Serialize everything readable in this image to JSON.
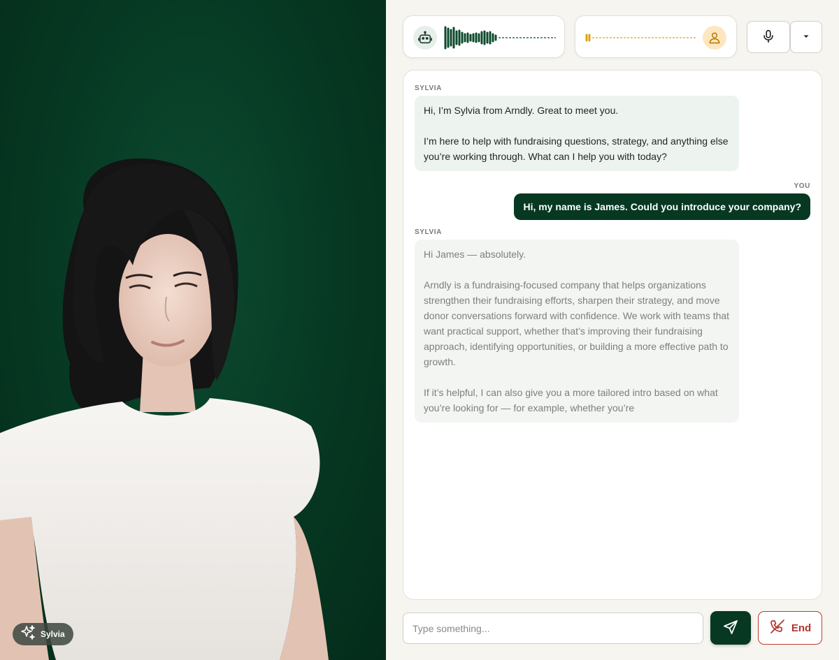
{
  "avatar": {
    "name_chip": "Sylvia",
    "chip_icon": "sparkles-icon"
  },
  "voice": {
    "bot_icon": "robot-icon",
    "user_icon": "user-icon",
    "mic_icon": "microphone-icon",
    "dropdown_icon": "caret-down-icon"
  },
  "chat": {
    "messages": [
      {
        "speaker": "SYLVIA",
        "role": "assistant",
        "paragraphs": [
          "Hi, I’m Sylvia from Arndly. Great to meet you.",
          "I’m here to help with fundraising questions, strategy, and anything else you’re working through. What can I help you with today?"
        ]
      },
      {
        "speaker": "YOU",
        "role": "user",
        "text": "Hi, my name is James. Could you introduce your company?"
      },
      {
        "speaker": "SYLVIA",
        "role": "assistant",
        "paragraphs": [
          "Hi James — absolutely.",
          "Arndly is a fundraising-focused company that helps organizations strengthen their fundraising efforts, sharpen their strategy, and move donor conversations forward with confidence. We work with teams that want practical support, whether that’s improving their fundraising approach, identifying opportunities, or building a more effective path to growth.",
          "If it’s helpful, I can also give you a more tailored intro based on what you’re looking for — for example, whether you’re"
        ]
      }
    ]
  },
  "composer": {
    "placeholder": "Type something...",
    "send_icon": "send-icon",
    "end_label": "End",
    "end_icon": "phone-hangup-icon"
  },
  "colors": {
    "brand_green": "#063822",
    "bot_wave": "#0d4a2e",
    "user_wave": "#e0a21a",
    "end_red": "#b2332a"
  }
}
